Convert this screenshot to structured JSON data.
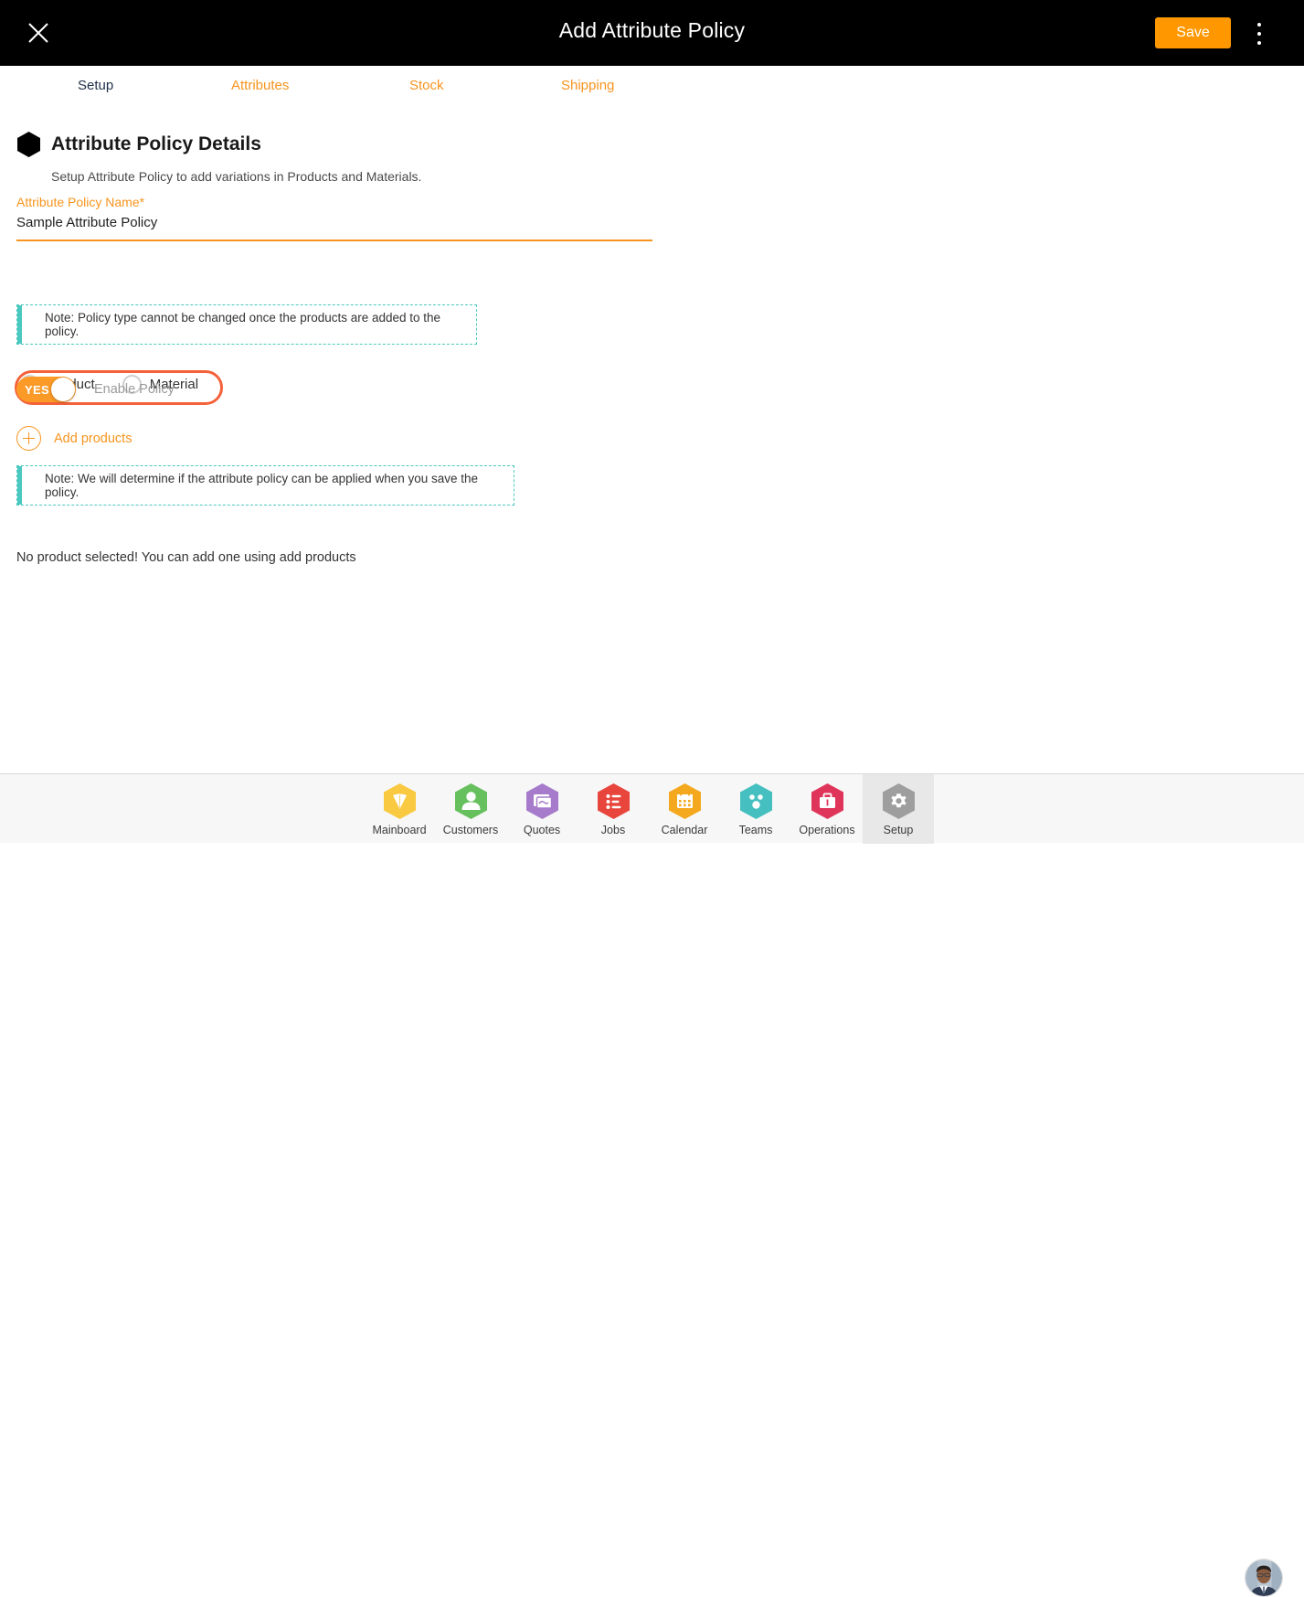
{
  "header": {
    "title": "Add Attribute Policy",
    "close_icon": "close-icon",
    "save_label": "Save",
    "menu_icon": "kebab-menu-icon",
    "save_color": "#FF9800",
    "background": "#000000"
  },
  "tabs": {
    "active_index": 0,
    "items": [
      {
        "label": "Setup",
        "active": true
      },
      {
        "label": "Attributes",
        "active": false
      },
      {
        "label": "Stock",
        "active": false
      },
      {
        "label": "Shipping",
        "active": false
      }
    ],
    "inactive_color": "#F7941E",
    "active_color": "#1f3047"
  },
  "main": {
    "section_icon": "hexagon-bullet-icon",
    "section_title": "Attribute Policy Details",
    "section_subtitle": "Setup Attribute Policy to add variations in Products and Materials.",
    "policy_name_field": {
      "label": "Attribute Policy Name",
      "required_marker": "*",
      "value": "Sample Attribute Policy",
      "placeholder": "Attribute Policy Name",
      "underline_color": "#F7941E"
    },
    "policy_type": {
      "highlight_color": "#F4623A",
      "selected": "Product",
      "options": [
        {
          "label": "Product",
          "checked": true
        },
        {
          "label": "Material",
          "checked": false
        }
      ],
      "selected_dot_color": "#4BC8C0"
    },
    "note_policy_type": "Note: Policy type cannot be changed once the products are added to the policy.",
    "enable_policy": {
      "toggle_text": "YES",
      "label": "Enable Policy",
      "on": true,
      "color": "#FB9A26"
    },
    "add_products": {
      "icon": "plus-circle-icon",
      "label": "Add products",
      "color": "#F7941E"
    },
    "note_apply_policy": "Note: We will determine if the attribute policy can be applied when you save the policy.",
    "note_accent_color": "#4BC8C0",
    "empty_state": "No product selected! You can add one using add products"
  },
  "bottom_nav": {
    "active": "Setup",
    "items": [
      {
        "label": "Mainboard",
        "icon": "mainboard-hexagon-icon",
        "color": "#F9C941",
        "active": false
      },
      {
        "label": "Customers",
        "icon": "customers-hexagon-icon",
        "color": "#66C05D",
        "active": false
      },
      {
        "label": "Quotes",
        "icon": "quotes-hexagon-icon",
        "color": "#A77BCB",
        "active": false
      },
      {
        "label": "Jobs",
        "icon": "jobs-hexagon-icon",
        "color": "#E8453C",
        "active": false
      },
      {
        "label": "Calendar",
        "icon": "calendar-hexagon-icon",
        "color": "#F4A81D",
        "active": false
      },
      {
        "label": "Teams",
        "icon": "teams-hexagon-icon",
        "color": "#45BFBF",
        "active": false
      },
      {
        "label": "Operations",
        "icon": "operations-hexagon-icon",
        "color": "#E0355A",
        "active": false
      },
      {
        "label": "Setup",
        "icon": "settings-gear-hexagon-icon",
        "color": "#9E9E9E",
        "active": true
      }
    ],
    "avatar": "user-avatar"
  }
}
